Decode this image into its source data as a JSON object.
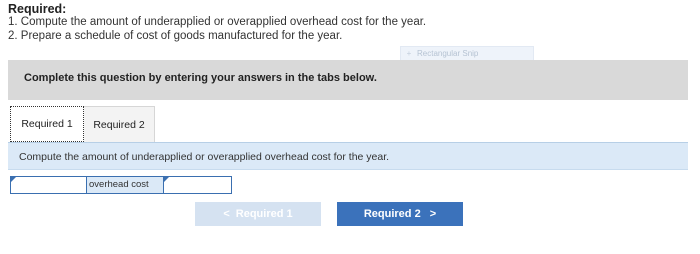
{
  "requirements": {
    "title": "Required:",
    "items": [
      "1. Compute the amount of underapplied or overapplied overhead cost for the year.",
      "2. Prepare a schedule of cost of goods manufactured for the year."
    ]
  },
  "snip_overlay": {
    "icon": "+",
    "label": "Rectangular Snip"
  },
  "banner": {
    "text": "Complete this question by entering your answers in the tabs below."
  },
  "tabs": [
    {
      "label": "Required 1",
      "active": true
    },
    {
      "label": "Required 2",
      "active": false
    }
  ],
  "content": {
    "instruction": "Compute the amount of underapplied or overapplied overhead cost for the year."
  },
  "answer_row": {
    "left_value": "",
    "label": "overhead cost",
    "right_value": ""
  },
  "nav": {
    "prev_label": "Required 1",
    "prev_chevron": "<",
    "next_label": "Required 2",
    "next_chevron": ">"
  },
  "colors": {
    "banner_bg": "#d9d9d9",
    "content_bg": "#dbe9f7",
    "accent_blue": "#3b72bb",
    "disabled_blue": "#d5e2f1"
  }
}
